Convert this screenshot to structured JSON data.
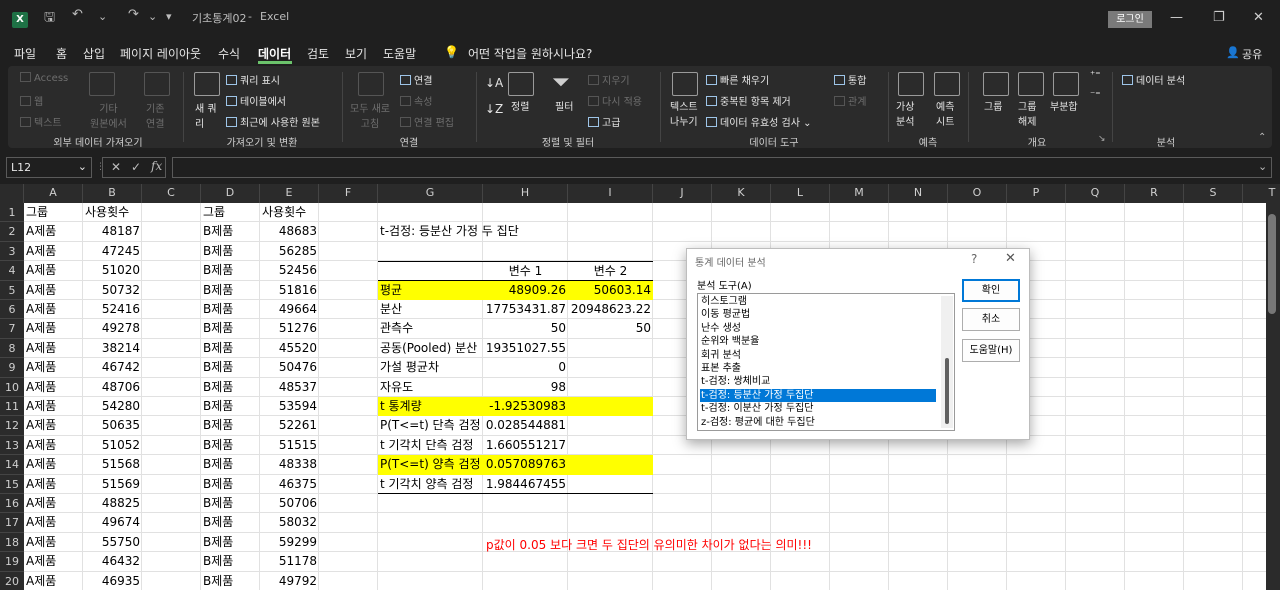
{
  "titlebar": {
    "filename": "기초통계02",
    "sep": "-",
    "app": "Excel",
    "login": "로그인",
    "minimize": "—",
    "restore": "❐",
    "close": "✕",
    "quick_dropdown": "▾"
  },
  "menubar": {
    "tabs": [
      "파일",
      "홈",
      "삽입",
      "페이지 레이아웃",
      "수식",
      "데이터",
      "검토",
      "보기",
      "도움말"
    ],
    "active": "데이터",
    "tell_me": "어떤 작업을 원하시나요?",
    "share": "공유"
  },
  "ribbon": {
    "get_external": {
      "label": "외부 데이터 가져오기",
      "access": "Access",
      "web": "웹",
      "text": "텍스트",
      "other": "기타\n원본에서",
      "existing": "기존\n연결"
    },
    "get_transform": {
      "label": "가져오기 및 변환",
      "new_query": "새 쿼\n리",
      "show_queries": "쿼리 표시",
      "from_table": "테이블에서",
      "recent": "최근에 사용한 원본"
    },
    "connections": {
      "label": "연결",
      "refresh_all": "모두 새로\n고침",
      "connections": "연결",
      "properties": "속성",
      "edit_links": "연결 편집"
    },
    "sort_filter": {
      "label": "정렬 및 필터",
      "sort": "정렬",
      "filter": "필터",
      "clear": "지우기",
      "reapply": "다시 적용",
      "advanced": "고급"
    },
    "data_tools": {
      "label": "데이터 도구",
      "text_to_columns": "텍스트\n나누기",
      "flash_fill": "빠른 채우기",
      "remove_dup": "중복된 항목 제거",
      "validation": "데이터 유효성 검사",
      "consolidate": "통합",
      "relations": "관계"
    },
    "forecast": {
      "label": "예측",
      "what_if": "가상\n분석",
      "sheet": "예측\n시트"
    },
    "outline": {
      "label": "개요",
      "group": "그룹",
      "ungroup": "그룹\n해제",
      "subtotal": "부분합"
    },
    "analysis": {
      "label": "분석",
      "data_analysis": "데이터 분석"
    }
  },
  "formula_bar": {
    "name_box": "L12",
    "fx": "fx",
    "cancel": "✕",
    "enter": "✓",
    "value": ""
  },
  "columns": [
    "A",
    "B",
    "C",
    "D",
    "E",
    "F",
    "G",
    "H",
    "I",
    "J",
    "K",
    "L",
    "M",
    "N",
    "O",
    "P",
    "Q",
    "R",
    "S",
    "T"
  ],
  "rows": [
    "1",
    "2",
    "3",
    "4",
    "5",
    "6",
    "7",
    "8",
    "9",
    "10",
    "11",
    "12",
    "13",
    "14",
    "15",
    "16",
    "17",
    "18",
    "19",
    "20"
  ],
  "table_left": {
    "header_group": "그룹",
    "header_count": "사용횟수",
    "groupA": "A제품",
    "groupB": "B제품",
    "A_values": [
      "48187",
      "47245",
      "51020",
      "50732",
      "52416",
      "49278",
      "38214",
      "46742",
      "48706",
      "54280",
      "50635",
      "51052",
      "51568",
      "51569",
      "48825",
      "49674",
      "55750",
      "46432",
      "46935"
    ],
    "B_values": [
      "48683",
      "56285",
      "52456",
      "51816",
      "49664",
      "51276",
      "45520",
      "50476",
      "48537",
      "53594",
      "52261",
      "51515",
      "48338",
      "46375",
      "50706",
      "58032",
      "59299",
      "51178",
      "49792"
    ]
  },
  "ttest": {
    "title": "t-검정: 등분산 가정 두 집단",
    "header_var1": "변수 1",
    "header_var2": "변수 2",
    "rows": [
      {
        "label": "평균",
        "v1": "48909.26",
        "v2": "50603.14",
        "highlight": true
      },
      {
        "label": "분산",
        "v1": "17753431.87",
        "v2": "20948623.22",
        "highlight": false
      },
      {
        "label": "관측수",
        "v1": "50",
        "v2": "50",
        "highlight": false
      },
      {
        "label": "공동(Pooled) 분산",
        "v1": "19351027.55",
        "v2": "",
        "highlight": false
      },
      {
        "label": "가설 평균차",
        "v1": "0",
        "v2": "",
        "highlight": false
      },
      {
        "label": "자유도",
        "v1": "98",
        "v2": "",
        "highlight": false
      },
      {
        "label": "t 통계량",
        "v1": "-1.92530983",
        "v2": "",
        "highlight": true
      },
      {
        "label": "P(T<=t) 단측 검정",
        "v1": "0.028544881",
        "v2": "",
        "highlight": false
      },
      {
        "label": "t 기각치 단측 검정",
        "v1": "1.660551217",
        "v2": "",
        "highlight": false
      },
      {
        "label": "P(T<=t) 양측 검정",
        "v1": "0.057089763",
        "v2": "",
        "highlight": true
      },
      {
        "label": "t 기각치 양측 검정",
        "v1": "1.984467455",
        "v2": "",
        "highlight": false
      }
    ]
  },
  "note": "p값이 0.05 보다  크면 두 집단의 유의미한 차이가 없다는 의미!!!",
  "dialog": {
    "title": "통계 데이터 분석",
    "help_q": "?",
    "close": "✕",
    "tools_label": "분석 도구(A)",
    "items": [
      "히스토그램",
      "이동 평균법",
      "난수 생성",
      "순위와 백분율",
      "회귀 분석",
      "표본 추출",
      "t-검정: 쌍체비교",
      "t-검정: 등분산 가정 두집단",
      "t-검정: 이분산 가정 두집단",
      "z-검정: 평균에 대한 두집단"
    ],
    "selected": "t-검정: 등분산 가정 두집단",
    "ok": "확인",
    "cancel": "취소",
    "help": "도움말(H)"
  }
}
